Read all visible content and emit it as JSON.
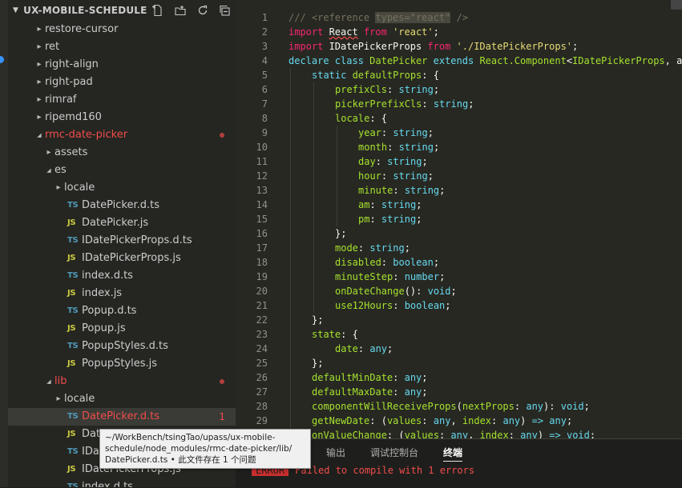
{
  "colors": {
    "sidebar_bg": "#252621",
    "editor_bg": "#272822",
    "selection": "#3a3b36",
    "error": "#f14c4c",
    "ts_icon": "#519aba",
    "js_icon": "#cbcb41"
  },
  "explorer": {
    "title": "UX-MOBILE-SCHEDULE",
    "actions": [
      {
        "name": "new-file-icon"
      },
      {
        "name": "new-folder-icon"
      },
      {
        "name": "refresh-icon"
      },
      {
        "name": "collapse-all-icon"
      }
    ],
    "tree": [
      {
        "label": "restore-cursor",
        "kind": "folder",
        "depth": 0,
        "expanded": false
      },
      {
        "label": "ret",
        "kind": "folder",
        "depth": 0,
        "expanded": false
      },
      {
        "label": "right-align",
        "kind": "folder",
        "depth": 0,
        "expanded": false
      },
      {
        "label": "right-pad",
        "kind": "folder",
        "depth": 0,
        "expanded": false
      },
      {
        "label": "rimraf",
        "kind": "folder",
        "depth": 0,
        "expanded": false
      },
      {
        "label": "ripemd160",
        "kind": "folder",
        "depth": 0,
        "expanded": false
      },
      {
        "label": "rmc-date-picker",
        "kind": "folder",
        "depth": 0,
        "expanded": true,
        "error": true,
        "dot": true
      },
      {
        "label": "assets",
        "kind": "folder",
        "depth": 1,
        "expanded": false
      },
      {
        "label": "es",
        "kind": "folder",
        "depth": 1,
        "expanded": true
      },
      {
        "label": "locale",
        "kind": "folder",
        "depth": 2,
        "expanded": false
      },
      {
        "label": "DatePicker.d.ts",
        "kind": "file",
        "icon": "TS",
        "depth": 2
      },
      {
        "label": "DatePicker.js",
        "kind": "file",
        "icon": "JS",
        "depth": 2
      },
      {
        "label": "IDatePickerProps.d.ts",
        "kind": "file",
        "icon": "TS",
        "depth": 2
      },
      {
        "label": "IDatePickerProps.js",
        "kind": "file",
        "icon": "JS",
        "depth": 2
      },
      {
        "label": "index.d.ts",
        "kind": "file",
        "icon": "TS",
        "depth": 2
      },
      {
        "label": "index.js",
        "kind": "file",
        "icon": "JS",
        "depth": 2
      },
      {
        "label": "Popup.d.ts",
        "kind": "file",
        "icon": "TS",
        "depth": 2
      },
      {
        "label": "Popup.js",
        "kind": "file",
        "icon": "JS",
        "depth": 2
      },
      {
        "label": "PopupStyles.d.ts",
        "kind": "file",
        "icon": "TS",
        "depth": 2
      },
      {
        "label": "PopupStyles.js",
        "kind": "file",
        "icon": "JS",
        "depth": 2
      },
      {
        "label": "lib",
        "kind": "folder",
        "depth": 1,
        "expanded": true,
        "error": true,
        "dot": true
      },
      {
        "label": "locale",
        "kind": "folder",
        "depth": 2,
        "expanded": false
      },
      {
        "label": "DatePicker.d.ts",
        "kind": "file",
        "icon": "TS",
        "depth": 2,
        "error": true,
        "selected": true,
        "badge": "1"
      },
      {
        "label": "DatePicker.js",
        "kind": "file",
        "icon": "JS",
        "depth": 2
      },
      {
        "label": "IDatePickerProps.d.ts",
        "kind": "file",
        "icon": "TS",
        "depth": 2
      },
      {
        "label": "IDatePickerProps.js",
        "kind": "file",
        "icon": "JS",
        "depth": 2
      },
      {
        "label": "index.d.ts",
        "kind": "file",
        "icon": "TS",
        "depth": 2
      }
    ]
  },
  "tooltip": {
    "lines": [
      "~/WorkBench/tsingTao/upass/ux-mobile-",
      "schedule/node_modules/rmc-date-picker/lib/",
      "DatePicker.d.ts • 此文件存在 1 个问题"
    ]
  },
  "editor": {
    "lines": [
      {
        "n": "1",
        "indent": 0,
        "tokens": [
          [
            "cm",
            "/// <reference "
          ],
          [
            "hl",
            "types=\"react\""
          ],
          [
            "cm",
            " />"
          ]
        ]
      },
      {
        "n": "2",
        "indent": 0,
        "tokens": [
          [
            "op",
            "import "
          ],
          [
            "sq",
            "React"
          ],
          [
            "op",
            " from "
          ],
          [
            "str",
            "'react'"
          ],
          [
            "plain",
            ";"
          ]
        ]
      },
      {
        "n": "3",
        "indent": 0,
        "tokens": [
          [
            "op",
            "import "
          ],
          [
            "plain",
            "IDatePickerProps"
          ],
          [
            "op",
            " from "
          ],
          [
            "str",
            "'./IDatePickerProps'"
          ],
          [
            "plain",
            ";"
          ]
        ]
      },
      {
        "n": "4",
        "indent": 0,
        "tokens": [
          [
            "kw",
            "declare class "
          ],
          [
            "prop",
            "DatePicker"
          ],
          [
            "kw",
            " extends "
          ],
          [
            "prop",
            "React.Component"
          ],
          [
            "plain",
            "<"
          ],
          [
            "prop",
            "IDatePickerProps"
          ],
          [
            "plain",
            ", a"
          ]
        ]
      },
      {
        "n": "5",
        "indent": 1,
        "tokens": [
          [
            "kw",
            "static "
          ],
          [
            "prop",
            "defaultProps"
          ],
          [
            "plain",
            ": {"
          ]
        ]
      },
      {
        "n": "6",
        "indent": 2,
        "tokens": [
          [
            "prop",
            "prefixCls"
          ],
          [
            "plain",
            ": "
          ],
          [
            "typ",
            "string"
          ],
          [
            "plain",
            ";"
          ]
        ]
      },
      {
        "n": "7",
        "indent": 2,
        "tokens": [
          [
            "prop",
            "pickerPrefixCls"
          ],
          [
            "plain",
            ": "
          ],
          [
            "typ",
            "string"
          ],
          [
            "plain",
            ";"
          ]
        ]
      },
      {
        "n": "8",
        "indent": 2,
        "tokens": [
          [
            "prop",
            "locale"
          ],
          [
            "plain",
            ": {"
          ]
        ]
      },
      {
        "n": "9",
        "indent": 3,
        "tokens": [
          [
            "prop",
            "year"
          ],
          [
            "plain",
            ": "
          ],
          [
            "typ",
            "string"
          ],
          [
            "plain",
            ";"
          ]
        ]
      },
      {
        "n": "10",
        "indent": 3,
        "tokens": [
          [
            "prop",
            "month"
          ],
          [
            "plain",
            ": "
          ],
          [
            "typ",
            "string"
          ],
          [
            "plain",
            ";"
          ]
        ]
      },
      {
        "n": "11",
        "indent": 3,
        "tokens": [
          [
            "prop",
            "day"
          ],
          [
            "plain",
            ": "
          ],
          [
            "typ",
            "string"
          ],
          [
            "plain",
            ";"
          ]
        ]
      },
      {
        "n": "12",
        "indent": 3,
        "tokens": [
          [
            "prop",
            "hour"
          ],
          [
            "plain",
            ": "
          ],
          [
            "typ",
            "string"
          ],
          [
            "plain",
            ";"
          ]
        ]
      },
      {
        "n": "13",
        "indent": 3,
        "tokens": [
          [
            "prop",
            "minute"
          ],
          [
            "plain",
            ": "
          ],
          [
            "typ",
            "string"
          ],
          [
            "plain",
            ";"
          ]
        ]
      },
      {
        "n": "14",
        "indent": 3,
        "tokens": [
          [
            "prop",
            "am"
          ],
          [
            "plain",
            ": "
          ],
          [
            "typ",
            "string"
          ],
          [
            "plain",
            ";"
          ]
        ]
      },
      {
        "n": "15",
        "indent": 3,
        "tokens": [
          [
            "prop",
            "pm"
          ],
          [
            "plain",
            ": "
          ],
          [
            "typ",
            "string"
          ],
          [
            "plain",
            ";"
          ]
        ]
      },
      {
        "n": "16",
        "indent": 2,
        "tokens": [
          [
            "plain",
            "};"
          ]
        ]
      },
      {
        "n": "17",
        "indent": 2,
        "tokens": [
          [
            "prop",
            "mode"
          ],
          [
            "plain",
            ": "
          ],
          [
            "typ",
            "string"
          ],
          [
            "plain",
            ";"
          ]
        ]
      },
      {
        "n": "18",
        "indent": 2,
        "tokens": [
          [
            "prop",
            "disabled"
          ],
          [
            "plain",
            ": "
          ],
          [
            "typ",
            "boolean"
          ],
          [
            "plain",
            ";"
          ]
        ]
      },
      {
        "n": "19",
        "indent": 2,
        "tokens": [
          [
            "prop",
            "minuteStep"
          ],
          [
            "plain",
            ": "
          ],
          [
            "typ",
            "number"
          ],
          [
            "plain",
            ";"
          ]
        ]
      },
      {
        "n": "20",
        "indent": 2,
        "tokens": [
          [
            "prop",
            "onDateChange"
          ],
          [
            "plain",
            "(): "
          ],
          [
            "typ",
            "void"
          ],
          [
            "plain",
            ";"
          ]
        ]
      },
      {
        "n": "21",
        "indent": 2,
        "tokens": [
          [
            "prop",
            "use12Hours"
          ],
          [
            "plain",
            ": "
          ],
          [
            "typ",
            "boolean"
          ],
          [
            "plain",
            ";"
          ]
        ]
      },
      {
        "n": "22",
        "indent": 1,
        "tokens": [
          [
            "plain",
            "};"
          ]
        ]
      },
      {
        "n": "23",
        "indent": 1,
        "tokens": [
          [
            "prop",
            "state"
          ],
          [
            "plain",
            ": {"
          ]
        ]
      },
      {
        "n": "24",
        "indent": 2,
        "tokens": [
          [
            "prop",
            "date"
          ],
          [
            "plain",
            ": "
          ],
          [
            "typ",
            "any"
          ],
          [
            "plain",
            ";"
          ]
        ]
      },
      {
        "n": "25",
        "indent": 1,
        "tokens": [
          [
            "plain",
            "};"
          ]
        ]
      },
      {
        "n": "26",
        "indent": 1,
        "tokens": [
          [
            "prop",
            "defaultMinDate"
          ],
          [
            "plain",
            ": "
          ],
          [
            "typ",
            "any"
          ],
          [
            "plain",
            ";"
          ]
        ]
      },
      {
        "n": "27",
        "indent": 1,
        "tokens": [
          [
            "prop",
            "defaultMaxDate"
          ],
          [
            "plain",
            ": "
          ],
          [
            "typ",
            "any"
          ],
          [
            "plain",
            ";"
          ]
        ]
      },
      {
        "n": "28",
        "indent": 1,
        "tokens": [
          [
            "prop",
            "componentWillReceiveProps"
          ],
          [
            "plain",
            "("
          ],
          [
            "prop",
            "nextProps"
          ],
          [
            "plain",
            ": "
          ],
          [
            "typ",
            "any"
          ],
          [
            "plain",
            "): "
          ],
          [
            "typ",
            "void"
          ],
          [
            "plain",
            ";"
          ]
        ]
      },
      {
        "n": "29",
        "indent": 1,
        "tokens": [
          [
            "prop",
            "getNewDate"
          ],
          [
            "plain",
            ": ("
          ],
          [
            "prop",
            "values"
          ],
          [
            "plain",
            ": "
          ],
          [
            "typ",
            "any"
          ],
          [
            "plain",
            ", "
          ],
          [
            "prop",
            "index"
          ],
          [
            "plain",
            ": "
          ],
          [
            "typ",
            "any"
          ],
          [
            "plain",
            ") "
          ],
          [
            "kw",
            "=>"
          ],
          [
            "plain",
            " "
          ],
          [
            "typ",
            "any"
          ],
          [
            "plain",
            ";"
          ]
        ]
      },
      {
        "n": "",
        "indent": 1,
        "tokens": [
          [
            "prop",
            "onValueChange"
          ],
          [
            "plain",
            ": ("
          ],
          [
            "prop",
            "values"
          ],
          [
            "plain",
            ": "
          ],
          [
            "typ",
            "any"
          ],
          [
            "plain",
            ", "
          ],
          [
            "prop",
            "index"
          ],
          [
            "plain",
            ": "
          ],
          [
            "typ",
            "any"
          ],
          [
            "plain",
            ") "
          ],
          [
            "kw",
            "=>"
          ],
          [
            "plain",
            " "
          ],
          [
            "typ",
            "void"
          ],
          [
            "plain",
            ":"
          ]
        ]
      }
    ]
  },
  "panel": {
    "tabs": [
      {
        "label": "输出",
        "active": false
      },
      {
        "label": "调试控制台",
        "active": false
      },
      {
        "label": "终端",
        "active": true
      }
    ],
    "output": {
      "badge": "ERROR",
      "message": "Failed to compile with 1 errors"
    }
  }
}
